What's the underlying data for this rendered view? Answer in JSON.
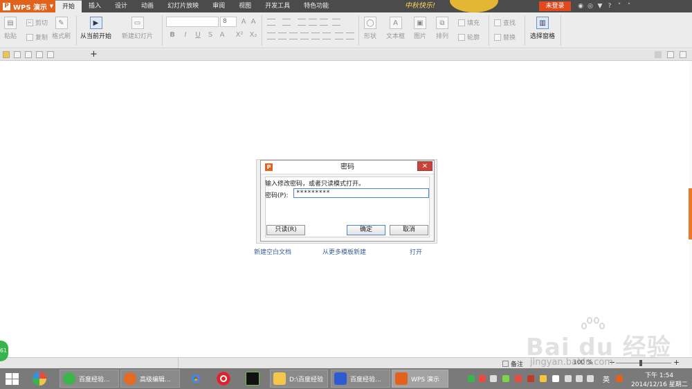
{
  "app": {
    "name": "WPS 演示",
    "logo_letter": "P"
  },
  "menu": {
    "tabs": [
      "开始",
      "插入",
      "设计",
      "动画",
      "幻灯片放映",
      "审阅",
      "视图",
      "开发工具",
      "特色功能"
    ],
    "active_tab": "开始",
    "festival_text": "中秋快乐!",
    "login_label": "未登录"
  },
  "ribbon": {
    "paste": "粘贴",
    "cut": "剪切",
    "copy": "复制",
    "format_painter": "格式刷",
    "play_from_current": "从当前开始",
    "new_slide": "新建幻灯片",
    "font_size": "8",
    "shape": "形状",
    "textbox": "文本框",
    "picture": "图片",
    "arrange": "排列",
    "fill": "填充",
    "outline": "轮廓",
    "find": "查找",
    "replace": "替换",
    "selection_pane": "选择窗格"
  },
  "start_page": {
    "new_blank": "新建空白文档",
    "from_template": "从更多模板新建",
    "open": "打开"
  },
  "dialog": {
    "title": "密码",
    "prompt": "输入修改密码，或者只读模式打开。",
    "password_label": "密码(P):",
    "password_value": "*********",
    "read_only_button": "只读(R)",
    "ok_button": "确定",
    "cancel_button": "取消"
  },
  "statusbar": {
    "notes": "备注",
    "zoom": "100 %",
    "badge": "61"
  },
  "taskbar": {
    "items": [
      "百度经验...",
      "高级编辑...",
      "D:\\百度经验",
      "百度经验...",
      "WPS 演示"
    ],
    "ime": "英",
    "time": "下午 1:54",
    "date": "2014/12/16 星期二"
  },
  "watermark": {
    "brand": "Bai du 经验",
    "url": "jingyan.baidu.com"
  },
  "colors": {
    "accent": "#e0621d",
    "titlebar": "#4b4b4b",
    "close": "#c94438",
    "focus": "#4a84c9"
  }
}
